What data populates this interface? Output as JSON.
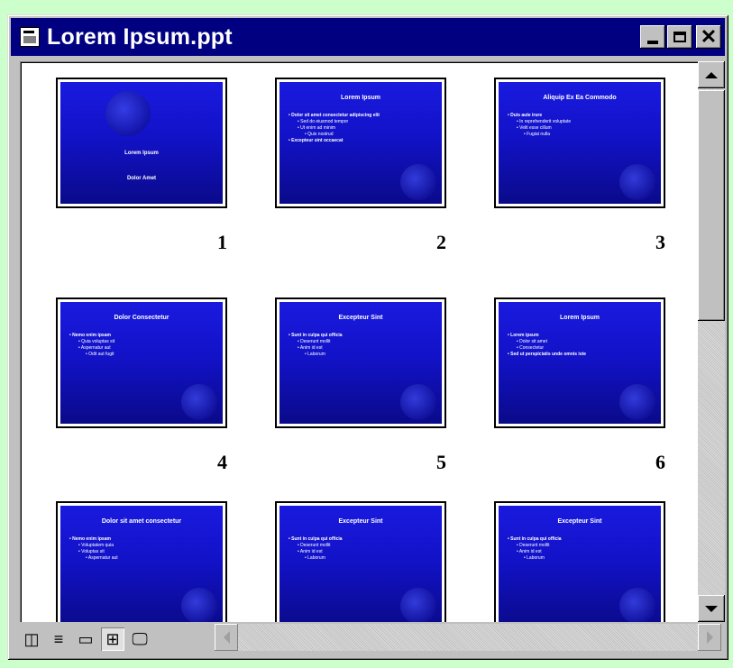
{
  "window": {
    "title": "Lorem Ipsum.ppt",
    "minimize_label": "minimize",
    "maximize_label": "maximize",
    "close_glyph": "✕"
  },
  "slides": [
    {
      "number": "1",
      "title": "Lorem Ipsum",
      "bullets": [
        "Dolor Amet"
      ],
      "kind": "title"
    },
    {
      "number": "2",
      "title": "Lorem Ipsum",
      "bullets": [
        "Dolor sit amet consectetur adipiscing elit",
        "Sed do eiusmod tempor",
        "Ut enim ad minim",
        "Quis nostrud",
        "Excepteur sint occaecat"
      ],
      "kind": "content"
    },
    {
      "number": "3",
      "title": "Aliquip Ex Ea Commodo",
      "bullets": [
        "Duis aute irure",
        "In reprehenderit voluptate",
        "Velit esse cillum",
        "Fugiat nulla"
      ],
      "kind": "content"
    },
    {
      "number": "4",
      "title": "Dolor Consectetur",
      "bullets": [
        "Nemo enim ipsam",
        "Quia voluptas sit",
        "Aspernatur aut",
        "Odit aut fugit"
      ],
      "kind": "content"
    },
    {
      "number": "5",
      "title": "Excepteur Sint",
      "bullets": [
        "Sunt in culpa qui officia",
        "Deserunt mollit",
        "Anim id est",
        "Laborum"
      ],
      "kind": "content"
    },
    {
      "number": "6",
      "title": "Lorem Ipsum",
      "bullets": [
        "Lorem ipsum",
        "Dolor sit amet",
        "Consectetur",
        "Sed ut perspiciatis unde omnis iste"
      ],
      "kind": "content"
    },
    {
      "number": "",
      "title": "Dolor sit amet consectetur",
      "bullets": [
        "Nemo enim ipsam",
        "Voluptatem quia",
        "Voluptas sit",
        "Aspernatur aut"
      ],
      "kind": "content"
    },
    {
      "number": "",
      "title": "Excepteur Sint",
      "bullets": [
        "Sunt in culpa qui officia",
        "Deserunt mollit",
        "Anim id est",
        "Laborum"
      ],
      "kind": "content"
    },
    {
      "number": "",
      "title": "Excepteur Sint",
      "bullets": [
        "Sunt in culpa qui officia",
        "Deserunt mollit",
        "Anim id est",
        "Laborum"
      ],
      "kind": "content"
    }
  ],
  "view_buttons": [
    {
      "name": "normal-view-icon",
      "glyph": "◫"
    },
    {
      "name": "outline-view-icon",
      "glyph": "≡"
    },
    {
      "name": "slide-view-icon",
      "glyph": "▭"
    },
    {
      "name": "slide-sorter-view-icon",
      "glyph": "⊞"
    },
    {
      "name": "slide-show-icon",
      "glyph": "🖵"
    }
  ],
  "colors": {
    "titlebar": "#000080",
    "slide_background": "#1414d0",
    "desktop": "#ccffcc"
  }
}
